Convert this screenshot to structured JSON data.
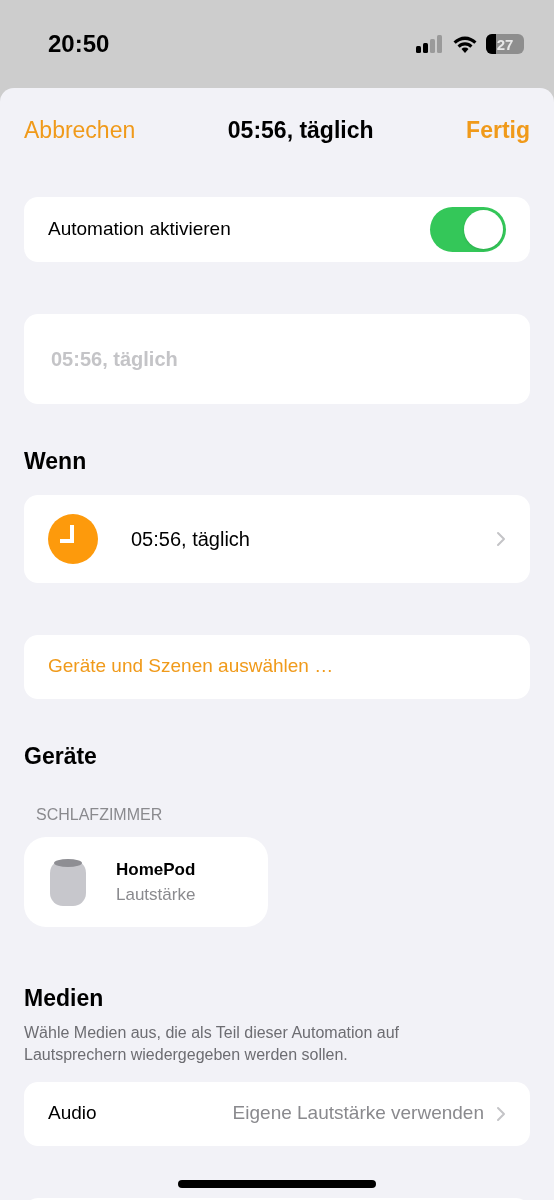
{
  "status_bar": {
    "time": "20:50",
    "battery": "27"
  },
  "nav": {
    "cancel": "Abbrechen",
    "title": "05:56, täglich",
    "done": "Fertig"
  },
  "enable_row": {
    "label": "Automation aktivieren",
    "on": true
  },
  "name_field": {
    "placeholder": "05:56, täglich"
  },
  "when": {
    "heading": "Wenn",
    "trigger": "05:56, täglich"
  },
  "select_link": "Geräte und Szenen auswählen …",
  "devices": {
    "heading": "Geräte",
    "room": "SCHLAFZIMMER",
    "items": [
      {
        "name": "HomePod",
        "detail": "Lautstärke"
      }
    ]
  },
  "media": {
    "heading": "Medien",
    "description": "Wähle Medien aus, die als Teil dieser Automation auf Lautsprechern wiedergegeben werden sollen.",
    "row_label": "Audio",
    "row_value": "Eigene Lautstärke verwenden"
  }
}
